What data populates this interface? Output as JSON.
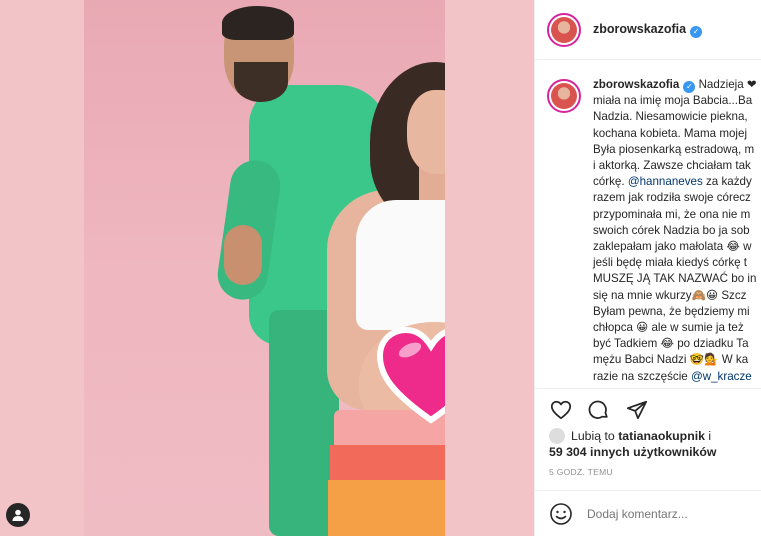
{
  "post": {
    "username": "zborowskazofia",
    "verified": true
  },
  "caption": {
    "username": "zborowskazofia",
    "lines": [
      "Nadzieja ❤",
      "miała na imię moja Babcia...Ba",
      "Nadzia. Niesamowicie piekna,",
      "kochana kobieta. Mama mojej",
      "Była piosenkarką estradową, m",
      "i aktorką. Zawsze chciałam tak",
      "córkę.",
      "razem jak rodziła swoje córecz",
      "przypominała mi, że ona nie m",
      "swoich córek Nadzia bo ja sob",
      "zaklepałam jako małolata 😂 w",
      "jeśli będę miała kiedyś córkę t",
      "MUSZĘ JĄ TAK NAZWAĆ bo in",
      "się na mnie wkurzy🙈😀 Szcz",
      "Byłam pewna, że będziemy mi",
      "chłopca 😀 ale w sumie ja też",
      "być Tadkiem 😂 po dziadku Ta",
      "mężu Babci Nadzi 🤓💁 W ka",
      "razie na szczęście"
    ],
    "mention_1": "@hannaneves",
    "mention_1_suffix": " za każdy",
    "mention_2": "@w_kracze"
  },
  "likes": {
    "prefix": "Lubią to ",
    "user": "tatianaokupnik",
    "suffix": " i",
    "count_text": "59 304 innych użytkowników"
  },
  "timestamp": "5 GODZ. TEMU",
  "comment": {
    "placeholder": "Dodaj komentarz..."
  },
  "icons": {
    "like": "heart-outline-icon",
    "comment": "comment-bubble-icon",
    "share": "paper-plane-icon",
    "emoji": "emoji-icon",
    "user": "user-icon",
    "censor": "pink-heart-icon"
  },
  "colors": {
    "verified": "#3897f0",
    "mention": "#00376b",
    "censor_heart": "#ee2a8a",
    "background": "#f2c4c8"
  }
}
